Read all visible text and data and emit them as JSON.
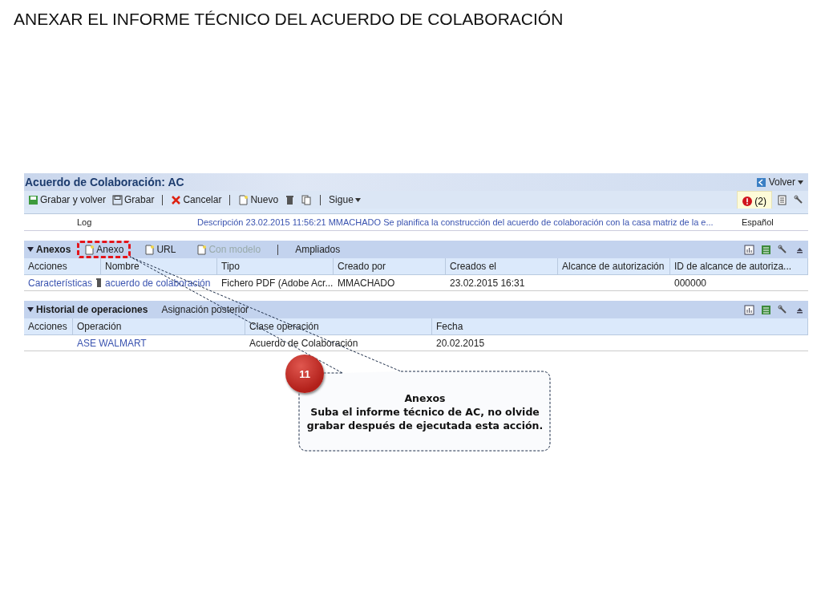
{
  "slide_title": "ANEXAR EL  INFORME TÉCNICO DEL ACUERDO DE COLABORACIÓN",
  "app": {
    "title": "Acuerdo de Colaboración: AC",
    "back_button": "Volver",
    "toolbar": [
      [
        {
          "kind": "save-back",
          "label": "Grabar y volver"
        },
        {
          "kind": "save",
          "label": "Grabar"
        }
      ],
      [
        {
          "kind": "cancel",
          "label": "Cancelar"
        }
      ],
      [
        {
          "kind": "new",
          "label": "Nuevo"
        },
        {
          "kind": "delete"
        },
        {
          "kind": "copy"
        }
      ],
      [
        {
          "kind": "menu",
          "label": "Sigue"
        }
      ]
    ],
    "messages": "(2)",
    "text_rows": [
      {
        "clase": "Log",
        "texto": "Descripción 23.02.2015 11:56:21 MMACHADO  Se planifica la construcción del acuerdo de colaboración con la casa matriz de la e...",
        "idioma": "Español"
      }
    ],
    "sections": [
      {
        "title": "Anexos",
        "expanded": true,
        "actions": [
          {
            "label": "Anexo",
            "kind": "new",
            "disabled": false,
            "highlighted": true
          },
          {
            "label": "URL",
            "kind": "new",
            "disabled": false,
            "highlighted": false
          },
          {
            "label": "Con modelo",
            "kind": "new",
            "disabled": true,
            "highlighted": false
          },
          {
            "label": "Ampliados",
            "kind": "text",
            "disabled": false,
            "highlighted": false
          }
        ],
        "columns": [
          "Acciones",
          "Nombre",
          "Tipo",
          "Creado por",
          "Creados el",
          "Alcance de autorización",
          "ID de alcance de autoriza..."
        ],
        "rows": [
          [
            {
              "text": "Características",
              "link": true,
              "trash": true
            },
            {
              "text": "acuerdo de colaboración",
              "link": true
            },
            {
              "text": "Fichero PDF (Adobe Acr...",
              "link": false
            },
            {
              "text": "MMACHADO",
              "link": false
            },
            {
              "text": "23.02.2015 16:31",
              "link": false
            },
            {},
            {
              "text": "000000",
              "link": false
            }
          ]
        ]
      },
      {
        "title": "Historial de operaciones",
        "expanded": true,
        "actions": [
          {
            "label": "Asignación posterior",
            "kind": "text",
            "disabled": false,
            "highlighted": false
          }
        ],
        "columns": [
          "Acciones",
          "Operación",
          "Clase operación",
          "Fecha"
        ],
        "rows": [
          [
            {},
            {
              "text": "ASE WALMART",
              "link": true
            },
            {
              "text": "Acuerdo de Colaboración",
              "link": false
            },
            {
              "text": "20.02.2015",
              "link": false
            }
          ]
        ]
      }
    ]
  },
  "annotation": {
    "number": "11",
    "title": "Anexos",
    "text": "Suba el informe técnico de AC, no olvide grabar después de ejecutada esta acción."
  }
}
